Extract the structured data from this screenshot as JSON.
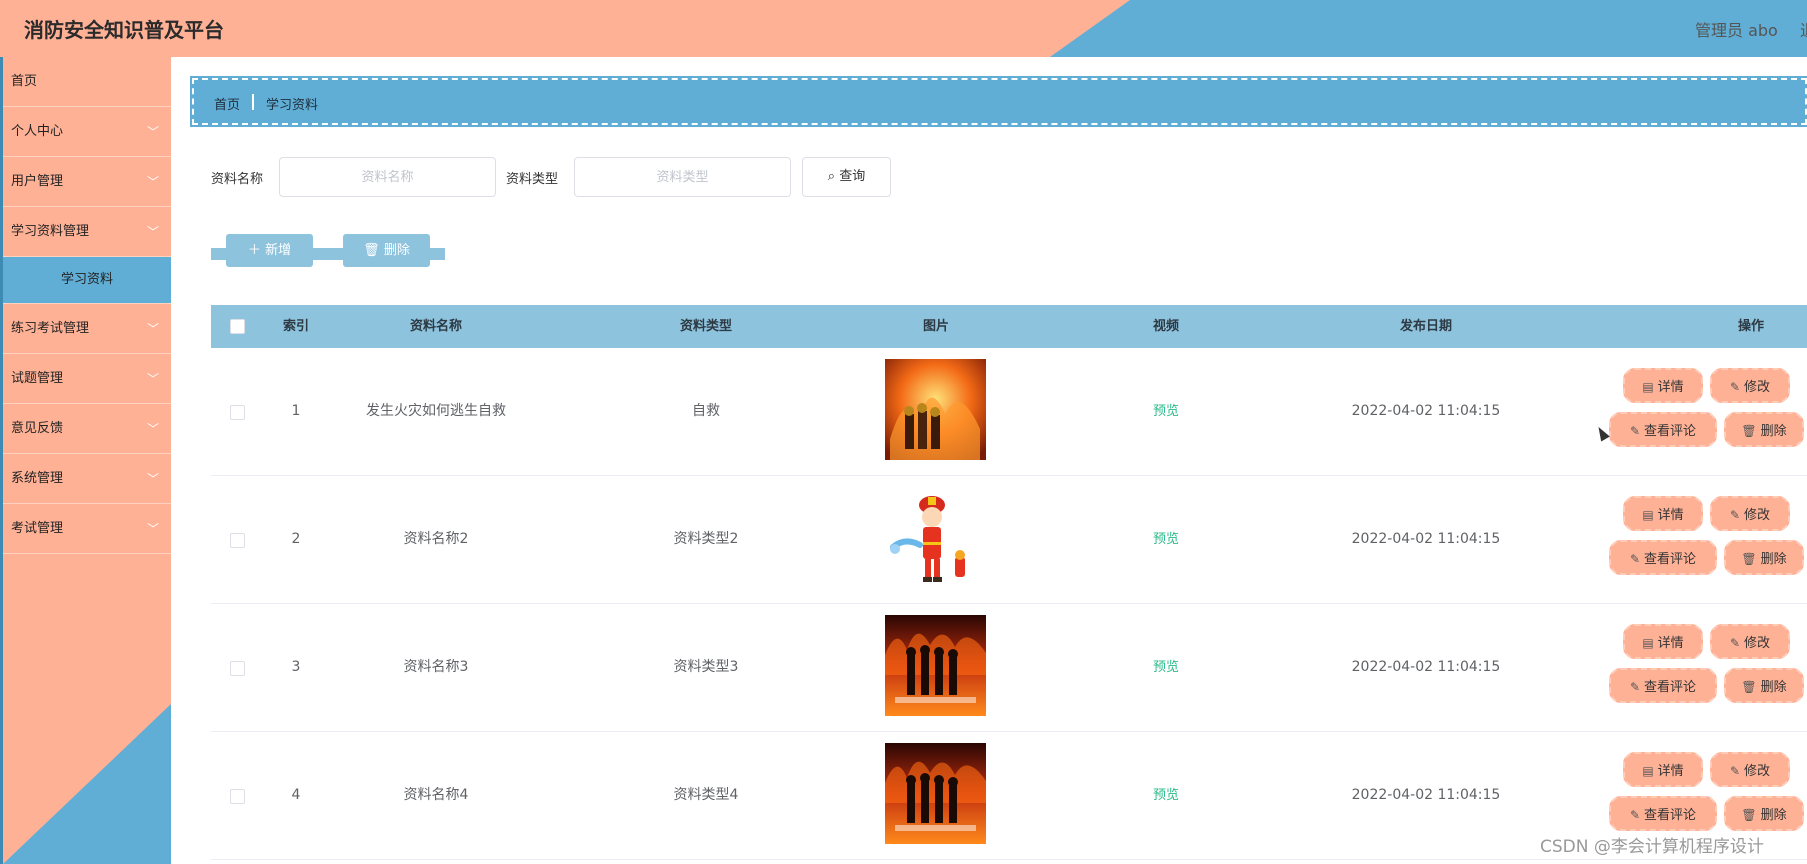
{
  "header": {
    "title": "消防安全知识普及平台",
    "admin": "管理员 abo",
    "admin_tail": "退"
  },
  "colors": {
    "accent_orange": "#ffb196",
    "accent_blue": "#60aed5",
    "table_head": "#8ec3de",
    "preview_green": "#2bb98a"
  },
  "sidebar": {
    "items": [
      {
        "label": "首页",
        "chevron": ""
      },
      {
        "label": "个人中心",
        "chevron": "﹀"
      },
      {
        "label": "用户管理",
        "chevron": "﹀"
      },
      {
        "label": "学习资料管理",
        "chevron": "﹀"
      },
      {
        "label": "学习资料"
      },
      {
        "label": "练习考试管理",
        "chevron": "﹀"
      },
      {
        "label": "试题管理",
        "chevron": "﹀"
      },
      {
        "label": "意见反馈",
        "chevron": "﹀"
      },
      {
        "label": "系统管理",
        "chevron": "﹀"
      },
      {
        "label": "考试管理",
        "chevron": "﹀"
      }
    ]
  },
  "breadcrumb": {
    "home": "首页",
    "current": "学习资料"
  },
  "search": {
    "name_label": "资料名称",
    "name_placeholder": "资料名称",
    "type_label": "资料类型",
    "type_placeholder": "资料类型",
    "query_label": "查询",
    "query_icon": "search-icon"
  },
  "toolbar": {
    "add_label": "新增",
    "delete_label": "删除"
  },
  "table": {
    "columns": [
      "索引",
      "资料名称",
      "资料类型",
      "图片",
      "视频",
      "发布日期",
      "操作"
    ],
    "rows": [
      {
        "index": "1",
        "name": "发生火灾如何逃生自救",
        "type": "自救",
        "image": "firefighters-spraying-fire",
        "video": "预览",
        "date": "2022-04-02 11:04:15"
      },
      {
        "index": "2",
        "name": "资料名称2",
        "type": "资料类型2",
        "image": "cartoon-firefighter-child",
        "video": "预览",
        "date": "2022-04-02 11:04:15"
      },
      {
        "index": "3",
        "name": "资料名称3",
        "type": "资料类型3",
        "image": "firefighters-silhouette-flames",
        "video": "预览",
        "date": "2022-04-02 11:04:15"
      },
      {
        "index": "4",
        "name": "资料名称4",
        "type": "资料类型4",
        "image": "firefighters-silhouette-flames",
        "video": "预览",
        "date": "2022-04-02 11:04:15"
      }
    ],
    "actions": {
      "detail": "详情",
      "edit": "修改",
      "comments": "查看评论",
      "delete": "删除"
    }
  },
  "watermark": "CSDN @李会计算机程序设计"
}
